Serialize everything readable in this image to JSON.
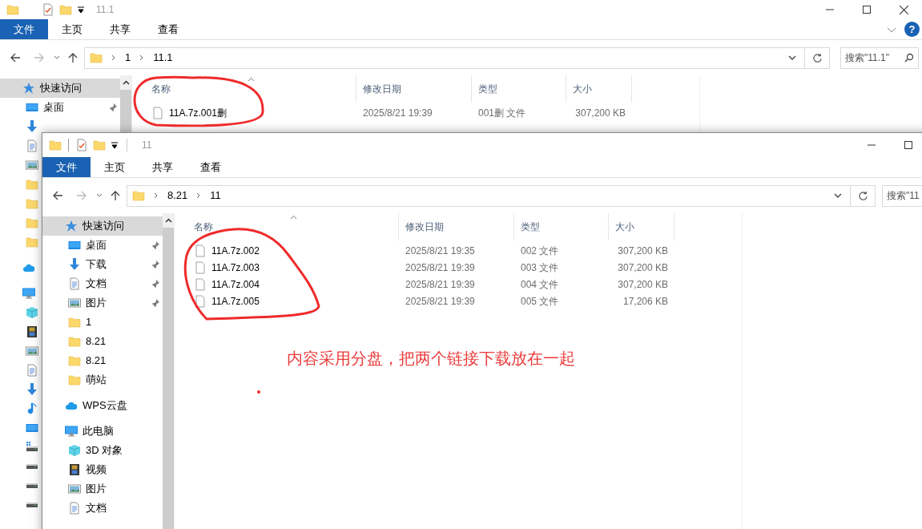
{
  "windows": [
    {
      "title": "11.1",
      "separators": false,
      "ribbon_tabs": [
        {
          "label": "文件",
          "selected": true
        },
        {
          "label": "主页",
          "selected": false
        },
        {
          "label": "共享",
          "selected": false
        },
        {
          "label": "查看",
          "selected": false
        }
      ],
      "help_button": "?",
      "breadcrumb": [
        "1",
        "11.1"
      ],
      "search": {
        "placeholder": "搜索\"11.1\""
      },
      "sidebar": [
        {
          "kind": "star",
          "label": "快速访问",
          "selected": true,
          "children": [
            {
              "kind": "desktop",
              "label": "桌面",
              "pinned": true
            },
            {
              "kind": "download"
            },
            {
              "kind": "document"
            },
            {
              "kind": "picture"
            },
            {
              "kind": "folder"
            },
            {
              "kind": "folder"
            },
            {
              "kind": "folder"
            },
            {
              "kind": "folder"
            }
          ]
        },
        {
          "kind": "cloud",
          "selected": false
        },
        {
          "kind": "pc",
          "selected": false,
          "children": [
            {
              "kind": "cube"
            },
            {
              "kind": "film"
            },
            {
              "kind": "picture"
            },
            {
              "kind": "document"
            },
            {
              "kind": "download"
            },
            {
              "kind": "music"
            },
            {
              "kind": "desktop"
            },
            {
              "kind": "drive-win"
            },
            {
              "kind": "drive"
            },
            {
              "kind": "drive"
            },
            {
              "kind": "drive"
            }
          ]
        }
      ],
      "columns": [
        "名称",
        "修改日期",
        "类型",
        "大小"
      ],
      "files": [
        {
          "name": "11A.7z.001删",
          "modified": "2025/8/21 19:39",
          "type": "001删 文件",
          "size": "307,200 KB"
        }
      ]
    },
    {
      "title": "11",
      "separators": true,
      "ribbon_tabs": [
        {
          "label": "文件",
          "selected": true
        },
        {
          "label": "主页",
          "selected": false
        },
        {
          "label": "共享",
          "selected": false
        },
        {
          "label": "查看",
          "selected": false
        }
      ],
      "breadcrumb": [
        "8.21",
        "11"
      ],
      "search": {
        "placeholder": "搜索\"11"
      },
      "sidebar": [
        {
          "kind": "star",
          "label": "快速访问",
          "selected": true,
          "children": [
            {
              "kind": "desktop",
              "label": "桌面",
              "pinned": true
            },
            {
              "kind": "download",
              "label": "下载",
              "pinned": true
            },
            {
              "kind": "document",
              "label": "文档",
              "pinned": true
            },
            {
              "kind": "picture",
              "label": "图片",
              "pinned": true
            },
            {
              "kind": "folder",
              "label": "1",
              "pinned": false
            },
            {
              "kind": "folder",
              "label": "8.21",
              "pinned": false
            },
            {
              "kind": "folder",
              "label": "8.21",
              "pinned": false
            },
            {
              "kind": "folder",
              "label": "萌站",
              "pinned": false
            }
          ]
        },
        {
          "kind": "cloud",
          "label": "WPS云盘",
          "selected": false
        },
        {
          "kind": "pc",
          "label": "此电脑",
          "selected": false,
          "children": [
            {
              "kind": "cube",
              "label": "3D 对象",
              "pinned": false
            },
            {
              "kind": "film",
              "label": "视频",
              "pinned": false
            },
            {
              "kind": "picture",
              "label": "图片",
              "pinned": false
            },
            {
              "kind": "document",
              "label": "文档",
              "pinned": false
            }
          ]
        }
      ],
      "columns": [
        "名称",
        "修改日期",
        "类型",
        "大小"
      ],
      "files": [
        {
          "name": "11A.7z.002",
          "modified": "2025/8/21 19:35",
          "type": "002 文件",
          "size": "307,200 KB"
        },
        {
          "name": "11A.7z.003",
          "modified": "2025/8/21 19:39",
          "type": "003 文件",
          "size": "307,200 KB"
        },
        {
          "name": "11A.7z.004",
          "modified": "2025/8/21 19:39",
          "type": "004 文件",
          "size": "307,200 KB"
        },
        {
          "name": "11A.7z.005",
          "modified": "2025/8/21 19:39",
          "type": "005 文件",
          "size": "17,206 KB"
        }
      ]
    }
  ],
  "annotations": [
    {
      "kind": "note",
      "text": "内容采用分盘，把两个链接下载放在一起"
    }
  ]
}
